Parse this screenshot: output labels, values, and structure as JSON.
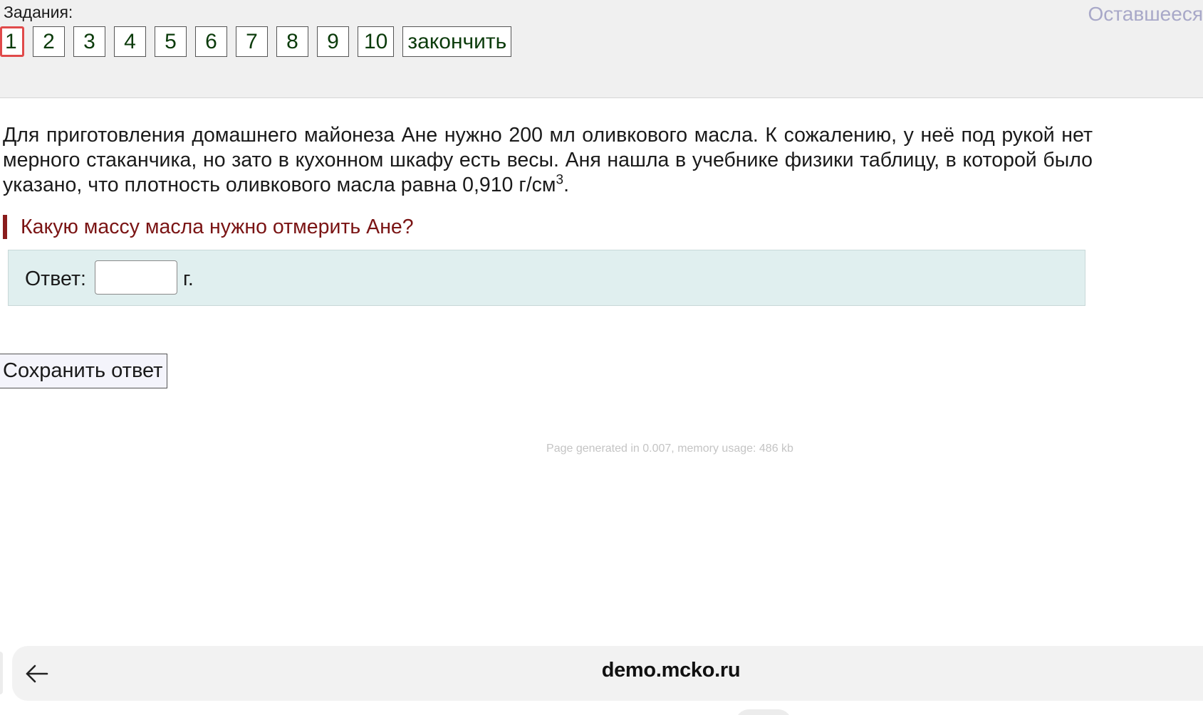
{
  "header": {
    "tasks_label": "Задания:",
    "remaining_label": "Оставшееся",
    "tasks": [
      {
        "label": "1",
        "active": true
      },
      {
        "label": "2",
        "active": false
      },
      {
        "label": "3",
        "active": false
      },
      {
        "label": "4",
        "active": false
      },
      {
        "label": "5",
        "active": false
      },
      {
        "label": "6",
        "active": false
      },
      {
        "label": "7",
        "active": false
      },
      {
        "label": "8",
        "active": false
      },
      {
        "label": "9",
        "active": false
      },
      {
        "label": "10",
        "active": false
      }
    ],
    "finish_label": "закончить"
  },
  "question": {
    "text": "Для приготовления домашнего майонеза Ане нужно 200 мл оливкового масла. К сожалению, у неё под рукой нет мерного стаканчика, но зато в кухонном шкафу есть весы. Аня нашла в учебнике физики таблицу, в которой было указано, что плотность оливкового масла равна 0,910 г/см",
    "superscript": "3",
    "text_end": ".",
    "prompt": "Какую массу масла нужно отмерить Ане?"
  },
  "answer": {
    "label": "Ответ:",
    "value": "",
    "unit": "г."
  },
  "save_label": "Сохранить ответ",
  "footer_note": "Page generated in 0.007, memory usage: 486 kb",
  "browser": {
    "url": "demo.mcko.ru",
    "back_icon": "arrow-left-icon"
  },
  "colors": {
    "active_task_border": "#e04a4a",
    "prompt_color": "#7a1414",
    "answer_box_bg": "#e0efef",
    "remaining_color": "#a8a8c8"
  }
}
